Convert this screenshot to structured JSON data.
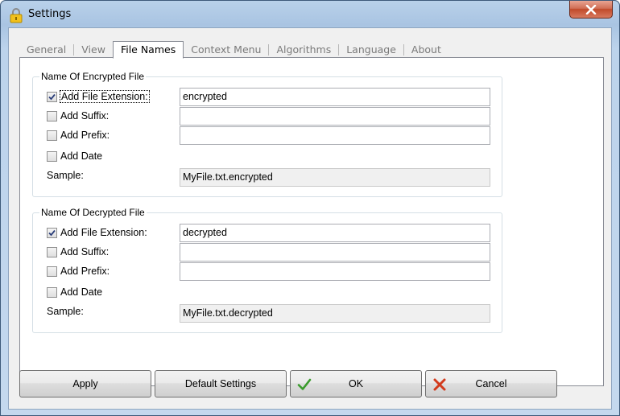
{
  "window": {
    "title": "Settings"
  },
  "tabs": [
    "General",
    "View",
    "File Names",
    "Context Menu",
    "Algorithms",
    "Language",
    "About"
  ],
  "active_tab": "File Names",
  "encrypted": {
    "legend": "Name Of Encrypted File",
    "add_extension": {
      "label": "Add File Extension:",
      "checked": true,
      "value": "encrypted"
    },
    "add_suffix": {
      "label": "Add Suffix:",
      "checked": false,
      "value": ""
    },
    "add_prefix": {
      "label": "Add Prefix:",
      "checked": false,
      "value": ""
    },
    "add_date": {
      "label": "Add Date",
      "checked": false
    },
    "sample_label": "Sample:",
    "sample_value": "MyFile.txt.encrypted"
  },
  "decrypted": {
    "legend": "Name Of Decrypted File",
    "add_extension": {
      "label": "Add File Extension:",
      "checked": true,
      "value": "decrypted"
    },
    "add_suffix": {
      "label": "Add Suffix:",
      "checked": false,
      "value": ""
    },
    "add_prefix": {
      "label": "Add Prefix:",
      "checked": false,
      "value": ""
    },
    "add_date": {
      "label": "Add Date",
      "checked": false
    },
    "sample_label": "Sample:",
    "sample_value": "MyFile.txt.decrypted"
  },
  "buttons": {
    "apply": "Apply",
    "default_settings": "Default Settings",
    "ok": "OK",
    "cancel": "Cancel"
  },
  "icons": {
    "title": "padlock-icon",
    "close": "close-icon",
    "ok": "checkmark-icon",
    "cancel": "cross-icon"
  },
  "colors": {
    "ok_icon": "#3a9b2c",
    "cancel_icon": "#d23a1c",
    "close_button": "#c75c3f"
  }
}
